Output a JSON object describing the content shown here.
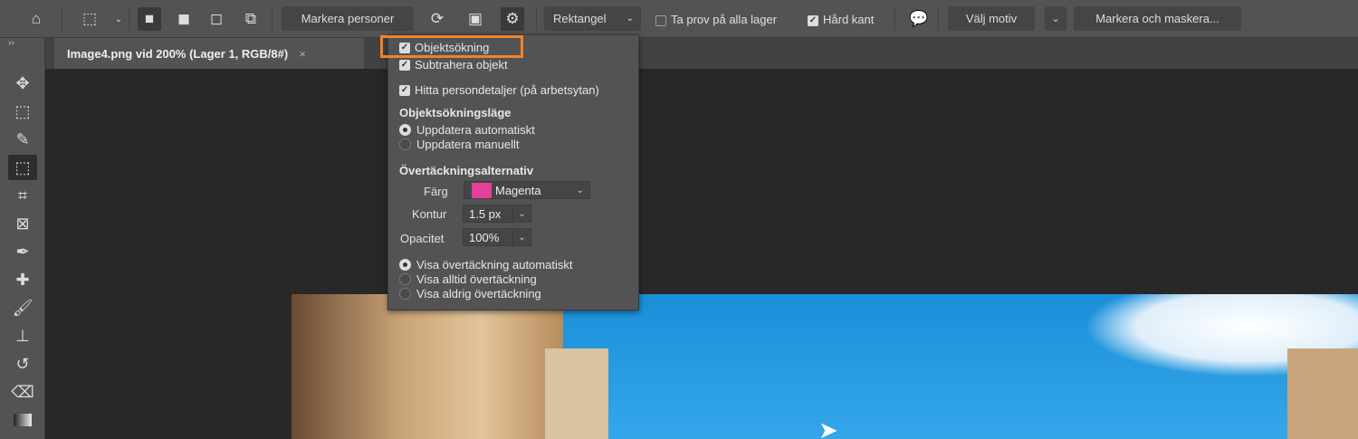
{
  "options_bar": {
    "preset_label": "Markera personer",
    "mode_select": "Rektangel",
    "sample_all_layers": {
      "label": "Ta prov på alla lager",
      "checked": false
    },
    "hard_edge": {
      "label": "Hård kant",
      "checked": true
    },
    "select_subject": "Välj motiv",
    "select_and_mask": "Markera och maskera..."
  },
  "document_tab": {
    "title": "Image4.png vid 200% (Lager 1, RGB/8#)",
    "close": "×"
  },
  "toolbox_collapse": "››",
  "settings_panel": {
    "object_finder": {
      "label": "Objektsökning",
      "checked": true
    },
    "subtract_object": {
      "label": "Subtrahera objekt",
      "checked": true
    },
    "find_person_details": {
      "label": "Hitta persondetaljer (på arbetsytan)",
      "checked": true
    },
    "mode_heading": "Objektsökningsläge",
    "mode_options": [
      {
        "label": "Uppdatera automatiskt",
        "selected": true
      },
      {
        "label": "Uppdatera manuellt",
        "selected": false
      }
    ],
    "overlay_heading": "Övertäckningsalternativ",
    "color_label": "Färg",
    "color_value": "Magenta",
    "color_swatch": "#e2409a",
    "stroke_label": "Kontur",
    "stroke_value": "1.5 px",
    "opacity_label": "Opacitet",
    "opacity_value": "100%",
    "overlay_options": [
      {
        "label": "Visa övertäckning automatiskt",
        "selected": true
      },
      {
        "label": "Visa alltid övertäckning",
        "selected": false
      },
      {
        "label": "Visa aldrig övertäckning",
        "selected": false
      }
    ]
  },
  "colors": {
    "highlight": "#f0822a"
  }
}
